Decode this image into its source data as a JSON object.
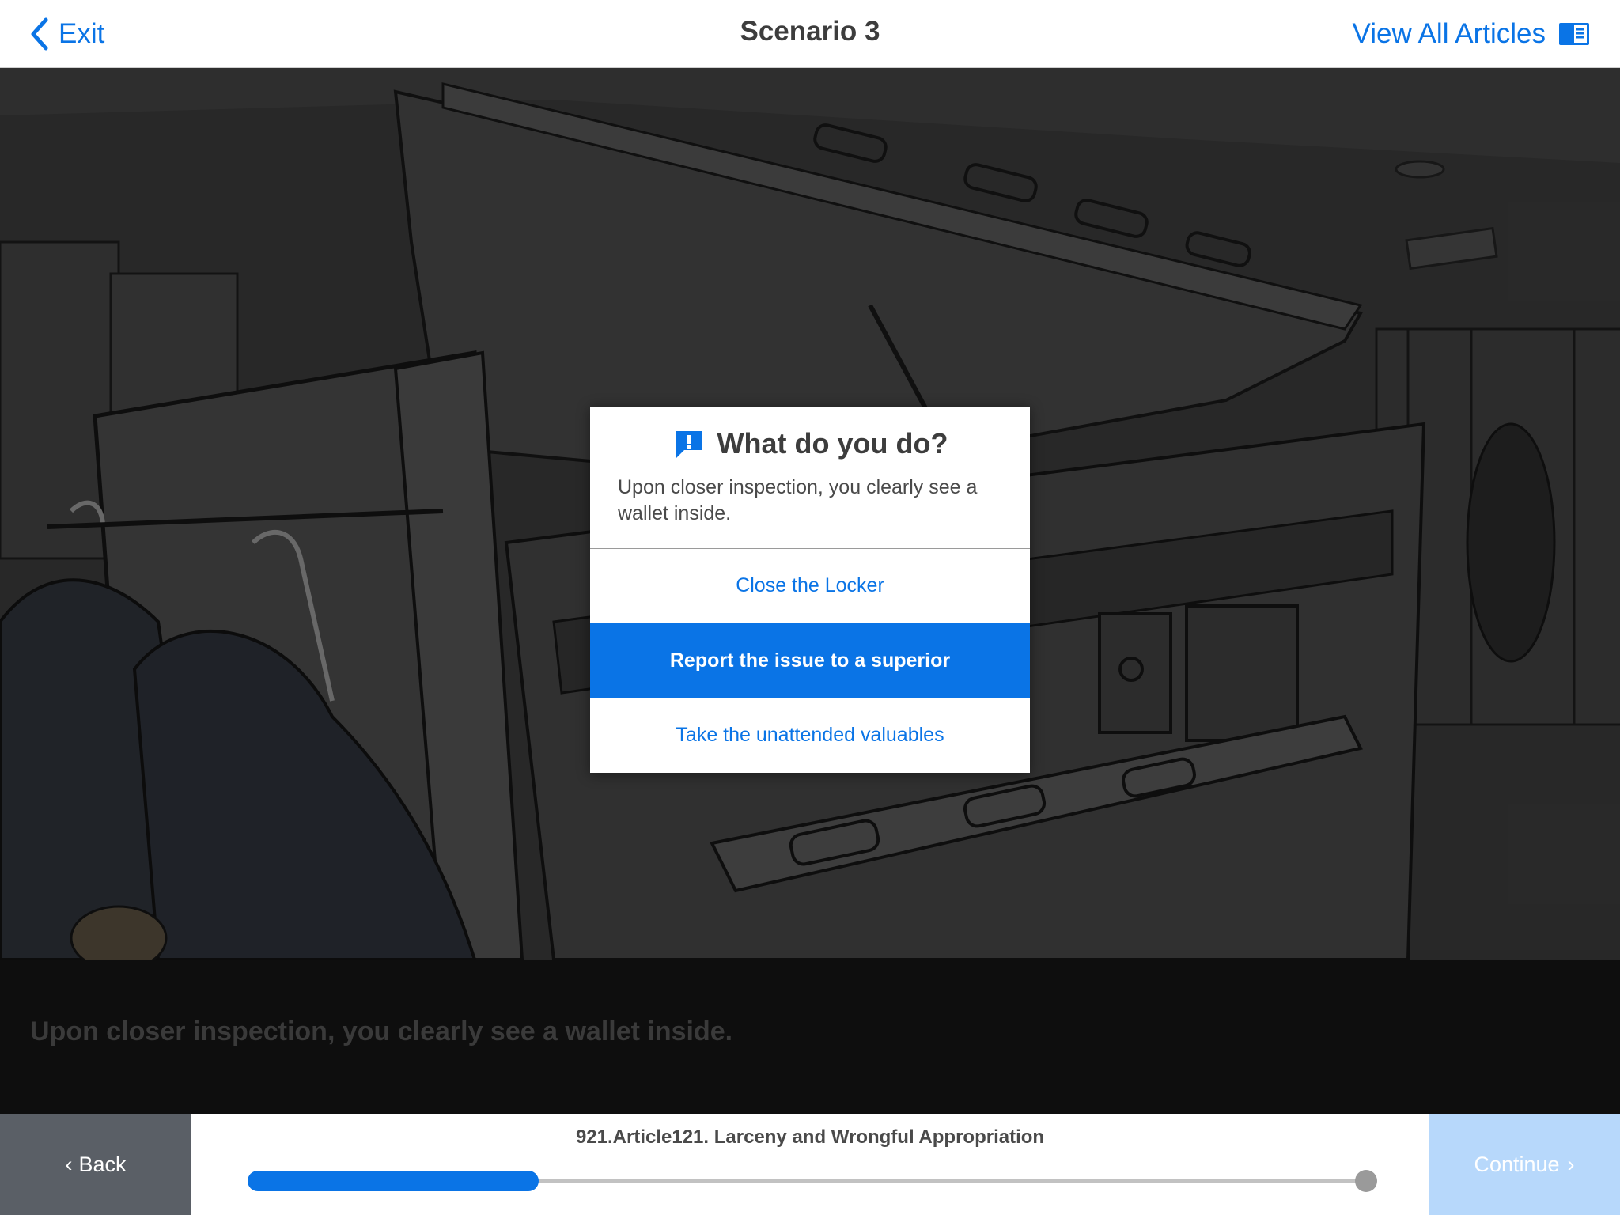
{
  "header": {
    "exit_label": "Exit",
    "title": "Scenario 3",
    "view_all_label": "View All Articles"
  },
  "dialog": {
    "title": "What do you do?",
    "body": "Upon closer inspection, you clearly see a wallet inside.",
    "choices": [
      {
        "label": "Close the Locker",
        "selected": false
      },
      {
        "label": "Report the issue to a superior",
        "selected": true
      },
      {
        "label": "Take the unattended valuables",
        "selected": false
      }
    ]
  },
  "caption": "Upon closer inspection, you clearly see a wallet inside.",
  "footer": {
    "back_label": "Back",
    "continue_label": "Continue",
    "article_title": "921.Article121. Larceny and Wrongful Appropriation",
    "progress": 0.26
  },
  "colors": {
    "accent": "#0a74e6",
    "continue_disabled": "#b7d8fb",
    "back_bg": "#5a5f66"
  },
  "icons": {
    "exit": "chevron-left-icon",
    "articles": "book-icon",
    "dialog": "alert-bubble-icon"
  }
}
